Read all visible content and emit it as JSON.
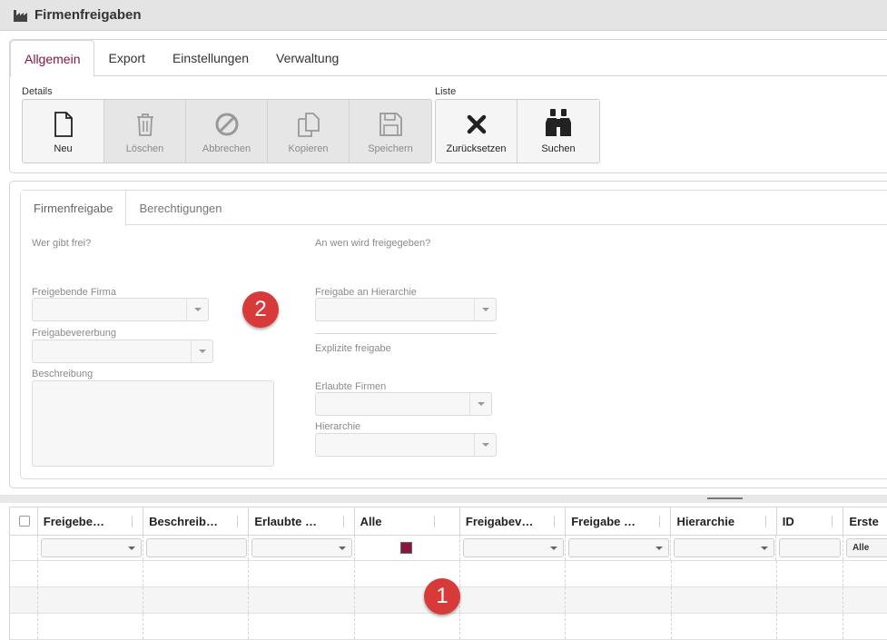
{
  "window": {
    "title": "Firmenfreigaben",
    "icon": "factory-icon"
  },
  "main_tabs": [
    {
      "label": "Allgemein",
      "active": true
    },
    {
      "label": "Export",
      "active": false
    },
    {
      "label": "Einstellungen",
      "active": false
    },
    {
      "label": "Verwaltung",
      "active": false
    }
  ],
  "toolbar": {
    "details_label": "Details",
    "liste_label": "Liste",
    "details_buttons": [
      {
        "label": "Neu",
        "icon": "new-document-icon",
        "enabled": true
      },
      {
        "label": "Löschen",
        "icon": "trash-icon",
        "enabled": false
      },
      {
        "label": "Abbrechen",
        "icon": "cancel-circle-icon",
        "enabled": false
      },
      {
        "label": "Kopieren",
        "icon": "copy-icon",
        "enabled": false
      },
      {
        "label": "Speichern",
        "icon": "save-icon",
        "enabled": false
      }
    ],
    "liste_buttons": [
      {
        "label": "Zurücksetzen",
        "icon": "x-icon",
        "enabled": true
      },
      {
        "label": "Suchen",
        "icon": "binoculars-icon",
        "enabled": true
      }
    ]
  },
  "detail_tabs": [
    {
      "label": "Firmenfreigabe",
      "active": true
    },
    {
      "label": "Berechtigungen",
      "active": false
    }
  ],
  "form": {
    "left_heading": "Wer gibt frei?",
    "right_heading": "An wen wird freigegeben?",
    "freigebende_firma_label": "Freigebende Firma",
    "freigebende_firma_value": "",
    "freigabevererbung_label": "Freigabevererbung",
    "freigabevererbung_value": "",
    "beschreibung_label": "Beschreibung",
    "beschreibung_value": "",
    "freigabe_hierarchie_label": "Freigabe an Hierarchie",
    "freigabe_hierarchie_value": "",
    "explizite_label": "Explizite freigabe",
    "erlaubte_firmen_label": "Erlaubte Firmen",
    "erlaubte_firmen_value": "",
    "hierarchie_label": "Hierarchie",
    "hierarchie_value": ""
  },
  "annotations": {
    "badge_1": "1",
    "badge_2": "2"
  },
  "grid": {
    "columns": [
      "Freigebe…",
      "Beschreib…",
      "Erlaubte …",
      "Alle",
      "Freigabev…",
      "Freigabe …",
      "Hierarchie",
      "ID",
      "Erste"
    ],
    "filter_alle_button": "Alle",
    "accent_color": "#8b1538",
    "rows": 3
  }
}
